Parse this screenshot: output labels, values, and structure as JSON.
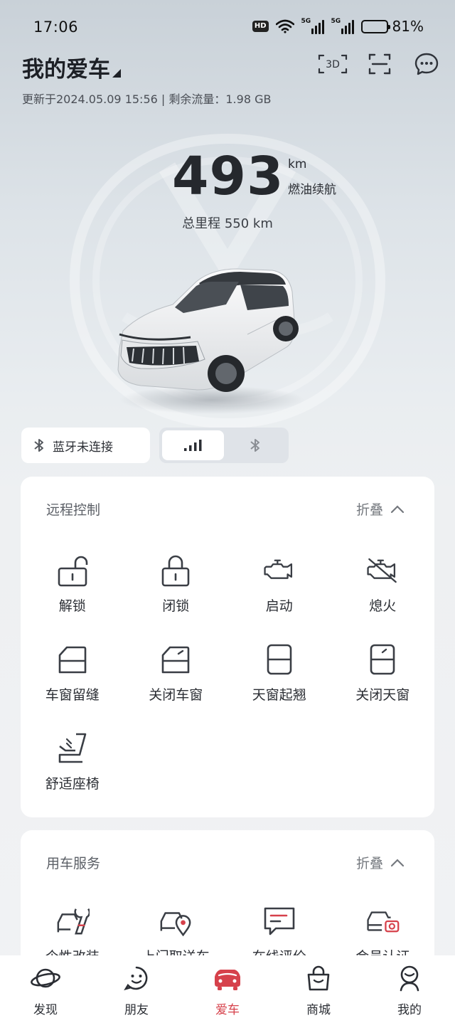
{
  "status_bar": {
    "time": "17:06",
    "hd_label": "HD",
    "network_label": "5G",
    "battery_percent": 81,
    "battery_label": "81%"
  },
  "header": {
    "title": "我的爱车",
    "update_text": "更新于2024.05.09 15:56 | 剩余流量：1.98 GB",
    "three_d_label": "3D"
  },
  "vehicle": {
    "range_value": "493",
    "range_unit": "km",
    "range_label": "燃油续航",
    "odometer_text": "总里程 550 km"
  },
  "connection": {
    "bluetooth_status": "蓝牙未连接",
    "active_mode": "cellular"
  },
  "remote_control": {
    "title": "远程控制",
    "fold_label": "折叠",
    "items": [
      {
        "label": "解锁",
        "icon": "unlock-icon"
      },
      {
        "label": "闭锁",
        "icon": "lock-icon"
      },
      {
        "label": "启动",
        "icon": "engine-icon"
      },
      {
        "label": "熄火",
        "icon": "engine-off-icon"
      },
      {
        "label": "车窗留缝",
        "icon": "window-vent-icon"
      },
      {
        "label": "关闭车窗",
        "icon": "window-close-icon"
      },
      {
        "label": "天窗起翘",
        "icon": "sunroof-tilt-icon"
      },
      {
        "label": "关闭天窗",
        "icon": "sunroof-close-icon"
      },
      {
        "label": "舒适座椅",
        "icon": "seat-icon"
      }
    ]
  },
  "car_service": {
    "title": "用车服务",
    "fold_label": "折叠",
    "items": [
      {
        "label": "个性改装",
        "icon": "car-wrench-icon"
      },
      {
        "label": "上门取送车",
        "icon": "car-location-icon"
      },
      {
        "label": "在线评价",
        "icon": "chat-review-icon"
      },
      {
        "label": "会员认证",
        "icon": "car-camera-icon"
      }
    ]
  },
  "bottom_nav": {
    "active": "爱车",
    "accent_color": "#d6414b",
    "items": [
      {
        "label": "发现",
        "icon": "planet-icon"
      },
      {
        "label": "朋友",
        "icon": "smile-chat-icon"
      },
      {
        "label": "爱车",
        "icon": "car-icon"
      },
      {
        "label": "商城",
        "icon": "shopping-bag-icon"
      },
      {
        "label": "我的",
        "icon": "profile-icon"
      }
    ]
  }
}
